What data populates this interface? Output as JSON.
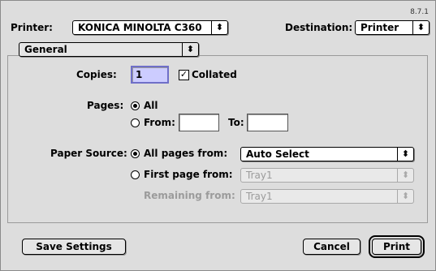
{
  "version": "8.7.1",
  "printer": {
    "label": "Printer:",
    "value": "KONICA MINOLTA C360"
  },
  "destination": {
    "label": "Destination:",
    "value": "Printer"
  },
  "panel": {
    "value": "General"
  },
  "copies": {
    "label": "Copies:",
    "value": "1",
    "collated_label": "Collated",
    "collated": true
  },
  "pages": {
    "label": "Pages:",
    "all_label": "All",
    "from_label": "From:",
    "to_label": "To:",
    "from_value": "",
    "to_value": "",
    "selected": "All"
  },
  "paper_source": {
    "label": "Paper Source:",
    "all_pages_label": "All pages from:",
    "all_pages_value": "Auto Select",
    "first_page_label": "First page from:",
    "first_page_value": "Tray1",
    "remaining_label": "Remaining from:",
    "remaining_value": "Tray1",
    "selected": "All pages from:"
  },
  "buttons": {
    "save": "Save Settings",
    "cancel": "Cancel",
    "print": "Print"
  },
  "icons": {
    "popup_arrow": "updown-arrow-icon",
    "check": "checkmark-icon"
  },
  "colors": {
    "focus_field": "#ccccff",
    "background": "#dddddd"
  }
}
